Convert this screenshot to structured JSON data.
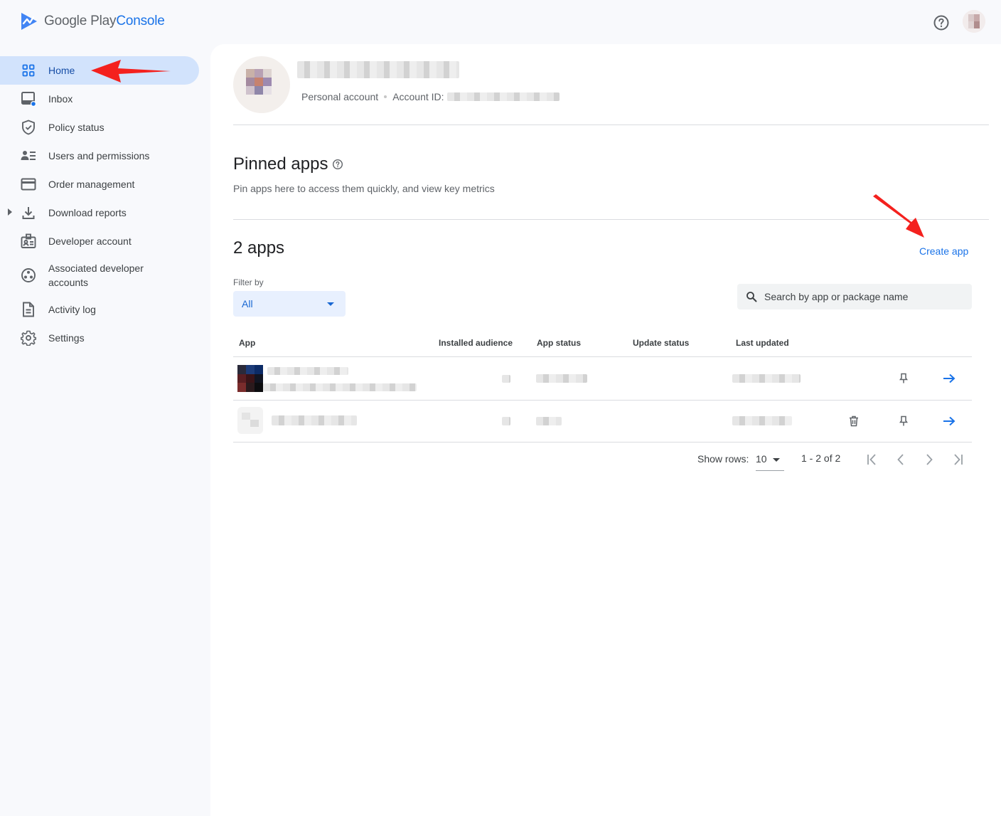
{
  "brand": {
    "google": "Google",
    "play": "Play",
    "console": "Console"
  },
  "colors": {
    "accent": "#1a73e8",
    "active_nav_bg": "#d2e3fc",
    "annotation_arrow": "#f4211e"
  },
  "sidebar": {
    "items": [
      {
        "label": "Home",
        "icon": "dashboard-grid-icon",
        "active": true
      },
      {
        "label": "Inbox",
        "icon": "inbox-icon"
      },
      {
        "label": "Policy status",
        "icon": "shield-check-icon"
      },
      {
        "label": "Users and permissions",
        "icon": "users-list-icon"
      },
      {
        "label": "Order management",
        "icon": "credit-card-icon"
      },
      {
        "label": "Download reports",
        "icon": "download-icon",
        "expandable": true
      },
      {
        "label": "Developer account",
        "icon": "id-badge-icon"
      },
      {
        "label": "Associated developer accounts",
        "icon": "linked-accounts-icon"
      },
      {
        "label": "Activity log",
        "icon": "document-icon"
      },
      {
        "label": "Settings",
        "icon": "gear-icon"
      }
    ]
  },
  "profile": {
    "account_type": "Personal account",
    "account_id_label": "Account ID:"
  },
  "pinned": {
    "title": "Pinned apps",
    "subtitle": "Pin apps here to access them quickly, and view key metrics"
  },
  "apps": {
    "count_label": "2 apps",
    "create_label": "Create app",
    "filter_label": "Filter by",
    "filter_value": "All",
    "search_placeholder": "Search by app or package name",
    "columns": [
      "App",
      "Installed audience",
      "App status",
      "Update status",
      "Last updated"
    ]
  },
  "pagination": {
    "show_rows_label": "Show rows:",
    "rows_value": "10",
    "range_label": "1 - 2 of 2"
  }
}
